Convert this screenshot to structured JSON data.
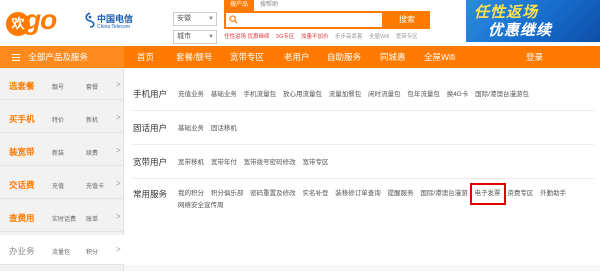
{
  "logo": {
    "circle": "欢",
    "word": "go"
  },
  "telecom": {
    "cn": "中国电信",
    "en": "China Telecom"
  },
  "location": {
    "province": "安徽",
    "city": "城市"
  },
  "search": {
    "tabs": [
      "搜产品",
      "搜帮助"
    ],
    "placeholder": "",
    "button": "搜索",
    "hot": [
      {
        "text": "任性返场 优惠继续",
        "red": true
      },
      {
        "text": "5G专区",
        "red": true
      },
      {
        "text": "加量不加价",
        "red": true
      },
      {
        "text": "步步高靠着",
        "red": false
      },
      {
        "text": "全屋Wifi",
        "red": false
      },
      {
        "text": "宽带专区",
        "red": false
      }
    ]
  },
  "banner": {
    "line1": "任性返场",
    "line2": "优惠继续"
  },
  "nav": {
    "all": "全部产品及服务",
    "items": [
      "首页",
      "套餐/靓号",
      "宽带专区",
      "老用户",
      "自助服务",
      "同城惠",
      "全屋Wifi",
      "登录"
    ]
  },
  "sidebar": [
    {
      "cat": "选套餐",
      "s1": "靓号",
      "s2": "套餐"
    },
    {
      "cat": "买手机",
      "s1": "特价",
      "s2": "新机"
    },
    {
      "cat": "装宽带",
      "s1": "新装",
      "s2": "续费"
    },
    {
      "cat": "交话费",
      "s1": "充值",
      "s2": "充值卡"
    },
    {
      "cat": "查费用",
      "s1": "实时话费",
      "s2": "账单"
    },
    {
      "cat": "办业务",
      "s1": "流量包",
      "s2": "积分"
    }
  ],
  "panel": {
    "rows": [
      {
        "head": "手机用户",
        "links": [
          "充值业务",
          "基础业务",
          "手机流量包",
          "放心用流量包",
          "流量加餐包",
          "闲时流量包",
          "包年流量包",
          "换4G卡",
          "国际/港澳台漫游包"
        ]
      },
      {
        "head": "固话用户",
        "links": [
          "基础业务",
          "固话移机"
        ]
      },
      {
        "head": "宽带用户",
        "links": [
          "宽带移机",
          "宽带年付",
          "宽带拨号密码修改",
          "宽带专区"
        ]
      },
      {
        "head": "常用服务",
        "links": [
          "我的积分",
          "积分俱乐部",
          "密码重置及修改",
          "实名补登",
          "装移修订单查询",
          "提醒服务",
          "国际/港澳台漫游",
          "电子发票",
          "资费专区",
          "外勤助手",
          "网络安全宣传周"
        ]
      }
    ]
  }
}
